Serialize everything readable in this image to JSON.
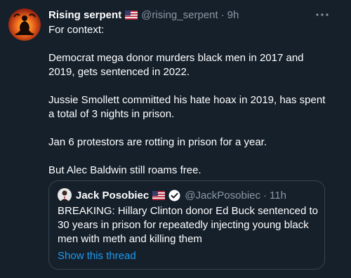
{
  "tweet": {
    "author": {
      "display_name": "Rising serpent",
      "flag_icon": "us-flag-icon",
      "handle": "@rising_serpent",
      "separator": "·",
      "time": "9h"
    },
    "more_icon": "more-horizontal-icon",
    "text": "For context:\n\nDemocrat mega donor murders black men in 2017 and 2019, gets sentenced in 2022.\n\nJussie Smollett committed his hate hoax in 2019, has spent a total of 3 nights in prison.\n\nJan 6 protestors are rotting in prison for a year.\n\nBut Alec Baldwin still roams free."
  },
  "quote": {
    "author": {
      "display_name": "Jack Posobiec",
      "flag_icon": "us-flag-icon",
      "verified_icon": "verified-badge-icon",
      "handle": "@JackPosobiec",
      "separator": "·",
      "time": "11h"
    },
    "text": "BREAKING: Hillary Clinton donor Ed Buck sentenced to 30 years in prison for repeatedly injecting young black men with meth and killing them",
    "show_thread": "Show this thread"
  },
  "colors": {
    "background": "#15202b",
    "secondary_text": "#8b98a5",
    "link": "#1d9bf0",
    "border": "#38444d"
  }
}
